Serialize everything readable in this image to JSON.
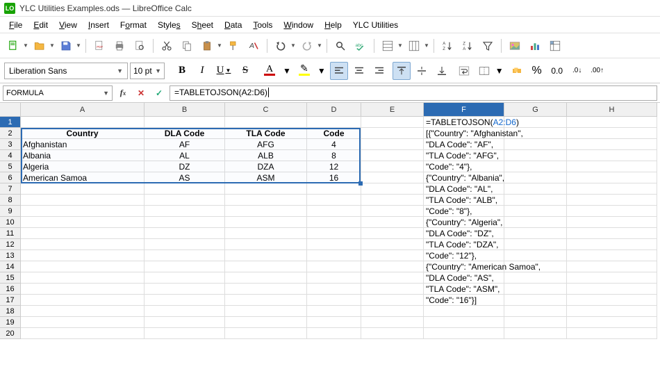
{
  "title": "YLC Utilities Examples.ods — LibreOffice Calc",
  "app_icon": "LO",
  "menus": [
    "File",
    "Edit",
    "View",
    "Insert",
    "Format",
    "Styles",
    "Sheet",
    "Data",
    "Tools",
    "Window",
    "Help",
    "YLC Utilities"
  ],
  "menu_underlines": [
    0,
    0,
    0,
    0,
    1,
    5,
    1,
    0,
    0,
    0,
    0,
    -1
  ],
  "font": {
    "name": "Liberation Sans",
    "size": "10 pt"
  },
  "namebox": "FORMULA",
  "formula": "=TABLETOJSON(A2:D6)",
  "columns": [
    {
      "label": "A",
      "w": 178
    },
    {
      "label": "B",
      "w": 116
    },
    {
      "label": "C",
      "w": 118
    },
    {
      "label": "D",
      "w": 78
    },
    {
      "label": "E",
      "w": 90
    },
    {
      "label": "F",
      "w": 116
    },
    {
      "label": "G",
      "w": 90
    },
    {
      "label": "H",
      "w": 130
    }
  ],
  "visible_rows": 20,
  "table": {
    "headers": [
      "Country",
      "DLA Code",
      "TLA Code",
      "Code"
    ],
    "rows": [
      [
        "Afghanistan",
        "AF",
        "AFG",
        "4"
      ],
      [
        "Albania",
        "AL",
        "ALB",
        "8"
      ],
      [
        "Algeria",
        "DZ",
        "DZA",
        "12"
      ],
      [
        "American Samoa",
        "AS",
        "ASM",
        "16"
      ]
    ]
  },
  "formula_display": {
    "prefix": "=TABLETOJSON(",
    "ref": "A2:D6",
    "suffix": ")"
  },
  "json_output_lines": [
    "[{\"Country\": \"Afghanistan\",",
    "\"DLA Code\": \"AF\",",
    "\"TLA Code\": \"AFG\",",
    "\"Code\": \"4\"},",
    "{\"Country\": \"Albania\",",
    "\"DLA Code\": \"AL\",",
    "\"TLA Code\": \"ALB\",",
    "\"Code\": \"8\"},",
    "{\"Country\": \"Algeria\",",
    "\"DLA Code\": \"DZ\",",
    "\"TLA Code\": \"DZA\",",
    "\"Code\": \"12\"},",
    "{\"Country\": \"American Samoa\",",
    "\"DLA Code\": \"AS\",",
    "\"TLA Code\": \"ASM\",",
    "\"Code\": \"16\"}]"
  ],
  "toolbar2_labels": {
    "bold": "B",
    "italic": "I",
    "underline": "U",
    "strike": "S",
    "fontcolor": "A",
    "highlight": "A",
    "pct": "%",
    "dec": ".0",
    "decminus": ".00",
    "decplus": "0.0"
  }
}
